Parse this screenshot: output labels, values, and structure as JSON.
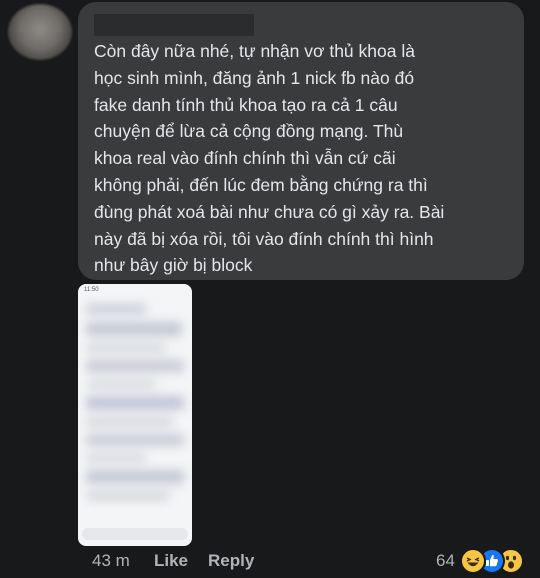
{
  "comment": {
    "author_redacted": true,
    "text": "Còn đây nữa nhé, tự nhận vơ thủ khoa là\nhọc sinh mình, đăng ảnh 1 nick fb nào đó\nfake danh tính thủ khoa tạo ra cả 1 câu\nchuyện để lừa cả cộng đồng mạng. Thù\nkhoa real vào đính chính thì vẫn cứ cãi\nkhông phải, đến lúc đem bằng chứng ra thì\nđùng phát xoá bài như chưa có gì xảy ra. Bài\nnày đã bị xóa rồi, tôi vào đính chính thì hình\nnhư bây giờ bị block"
  },
  "attachment": {
    "type": "blurred-phone-screenshot",
    "status_time": "11:50"
  },
  "footer": {
    "time": "43 m",
    "like_label": "Like",
    "reply_label": "Reply",
    "reaction_count": "64",
    "reactions": [
      "haha-icon",
      "like-icon",
      "wow-icon"
    ]
  },
  "colors": {
    "background": "#18191a",
    "bubble": "#3a3b3c",
    "text": "#e4e6eb",
    "meta": "#b0b3b8",
    "like_blue": "#1877f2",
    "emoji_yellow": "#f7c744"
  }
}
